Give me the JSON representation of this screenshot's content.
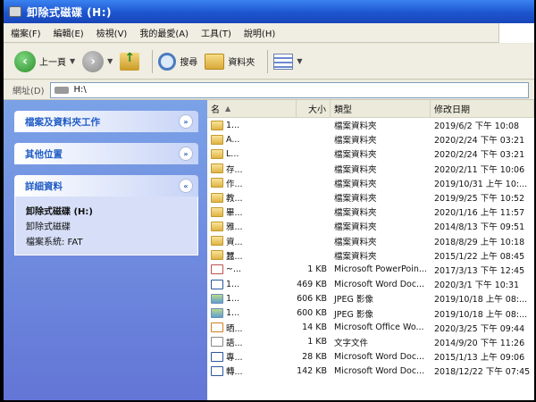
{
  "window": {
    "title": "卸除式磁碟 (H:)"
  },
  "menu": [
    "檔案(F)",
    "編輯(E)",
    "檢視(V)",
    "我的最愛(A)",
    "工具(T)",
    "說明(H)"
  ],
  "toolbar": {
    "back_label": "上一頁",
    "search_label": "搜尋",
    "folders_label": "資料夾"
  },
  "address": {
    "label": "網址(D)",
    "value": "H:\\"
  },
  "tasks": {
    "file_folder_tasks": "檔案及資料夾工作",
    "other_places": "其他位置",
    "details": "詳細資料",
    "details_name": "卸除式磁碟 (H:)",
    "details_type": "卸除式磁碟",
    "details_fs": "檔案系統: FAT"
  },
  "columns": {
    "name": "名",
    "size": "大小",
    "type": "類型",
    "date": "修改日期"
  },
  "files": [
    {
      "icon": "folder",
      "name": "1...",
      "size": "",
      "type": "檔案資料夾",
      "date": "2019/6/2 下午 10:08"
    },
    {
      "icon": "folder",
      "name": "A...",
      "size": "",
      "type": "檔案資料夾",
      "date": "2020/2/24 下午 03:21"
    },
    {
      "icon": "folder",
      "name": "L...",
      "size": "",
      "type": "檔案資料夾",
      "date": "2020/2/24 下午 03:21"
    },
    {
      "icon": "folder",
      "name": "存...",
      "size": "",
      "type": "檔案資料夾",
      "date": "2020/2/11 下午 10:06"
    },
    {
      "icon": "folder",
      "name": "作...",
      "size": "",
      "type": "檔案資料夾",
      "date": "2019/10/31 上午 10:..."
    },
    {
      "icon": "folder",
      "name": "教...",
      "size": "",
      "type": "檔案資料夾",
      "date": "2019/9/25 下午 10:52"
    },
    {
      "icon": "folder",
      "name": "畢...",
      "size": "",
      "type": "檔案資料夾",
      "date": "2020/1/16 上午 11:57"
    },
    {
      "icon": "folder",
      "name": "雅...",
      "size": "",
      "type": "檔案資料夾",
      "date": "2014/8/13 下午 09:51"
    },
    {
      "icon": "folder",
      "name": "資...",
      "size": "",
      "type": "檔案資料夾",
      "date": "2018/8/29 上午 10:18"
    },
    {
      "icon": "folder",
      "name": "蠶...",
      "size": "",
      "type": "檔案資料夾",
      "date": "2015/1/22 上午 08:45"
    },
    {
      "icon": "ppt",
      "name": "~...",
      "size": "1 KB",
      "type": "Microsoft PowerPoin...",
      "date": "2017/3/13 下午 12:45"
    },
    {
      "icon": "doc",
      "name": "1...",
      "size": "469 KB",
      "type": "Microsoft Word Doc...",
      "date": "2020/3/1 下午 10:31"
    },
    {
      "icon": "jpg",
      "name": "1...",
      "size": "606 KB",
      "type": "JPEG 影像",
      "date": "2019/10/18 上午 08:..."
    },
    {
      "icon": "jpg",
      "name": "1...",
      "size": "600 KB",
      "type": "JPEG 影像",
      "date": "2019/10/18 上午 08:..."
    },
    {
      "icon": "office",
      "name": "晒...",
      "size": "14 KB",
      "type": "Microsoft Office Wo...",
      "date": "2020/3/25 下午 09:44"
    },
    {
      "icon": "txt",
      "name": "語...",
      "size": "1 KB",
      "type": "文字文件",
      "date": "2014/9/20 下午 11:26"
    },
    {
      "icon": "doc",
      "name": "專...",
      "size": "28 KB",
      "type": "Microsoft Word Doc...",
      "date": "2015/1/13 上午 09:06"
    },
    {
      "icon": "doc",
      "name": "轉...",
      "size": "142 KB",
      "type": "Microsoft Word Doc...",
      "date": "2018/12/22 下午 07:45"
    }
  ]
}
